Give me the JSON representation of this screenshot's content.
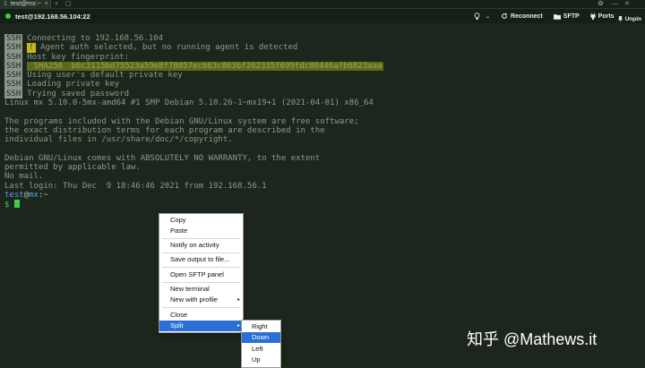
{
  "window": {
    "tab_number": "1",
    "tab_title": "test@mx:~",
    "tab_close": "×",
    "new_tab": "+",
    "restore": "▢",
    "settings_icon": "gear-icon",
    "close_icon": "close-icon"
  },
  "header": {
    "title": "test@192.168.56.104:22",
    "reconnect_label": "Reconnect",
    "sftp_label": "SFTP",
    "ports_label": "Ports",
    "unpin_label": "Unpin"
  },
  "terminal": {
    "ssh_badge": "SSH",
    "lines": [
      {
        "badge": true,
        "text": "Connecting to 192.168.56.104"
      },
      {
        "badge": true,
        "warn": "!",
        "text": " Agent auth selected, but no running agent is detected"
      },
      {
        "badge": true,
        "text": "Host key fingerprint:"
      },
      {
        "badge": true,
        "prefix": " SHA256 ",
        "hash": "b6c3115bd75523a59e8f78057ecb63c863bf262335f699fdc80446afb6823aaa"
      },
      {
        "badge": true,
        "text": "Using user's default private key"
      },
      {
        "badge": true,
        "text": "Loading private key"
      },
      {
        "badge": true,
        "text": "Trying saved password"
      }
    ],
    "uname": "Linux mx 5.10.0-5mx-amd64 #1 SMP Debian 5.10.26-1~mx19+1 (2021-04-01) x86_64",
    "motd1": "The programs included with the Debian GNU/Linux system are free software;",
    "motd2": "the exact distribution terms for each program are described in the",
    "motd3": "individual files in /usr/share/doc/*/copyright.",
    "motd4": "Debian GNU/Linux comes with ABSOLUTELY NO WARRANTY, to the extent",
    "motd5": "permitted by applicable law.",
    "nomail": "No mail.",
    "lastlogin": "Last login: Thu Dec  9 18:46:46 2021 from 192.168.56.1",
    "prompt_user": "test",
    "prompt_at": "@",
    "prompt_host": "mx",
    "prompt_path": ":~",
    "prompt_symbol": "$"
  },
  "context_menu": {
    "copy": "Copy",
    "paste": "Paste",
    "notify": "Notify on activity",
    "save_output": "Save output to file...",
    "open_sftp": "Open SFTP panel",
    "new_terminal": "New terminal",
    "new_profile": "New with profile",
    "close": "Close",
    "split": "Split"
  },
  "split_menu": {
    "right": "Right",
    "down": "Down",
    "left": "Left",
    "up": "Up"
  },
  "watermark": "知乎 @Mathews.it",
  "colors": {
    "background": "#1c261c",
    "prompt_green": "#3ecf4a",
    "menu_highlight": "#2a6fd6"
  }
}
